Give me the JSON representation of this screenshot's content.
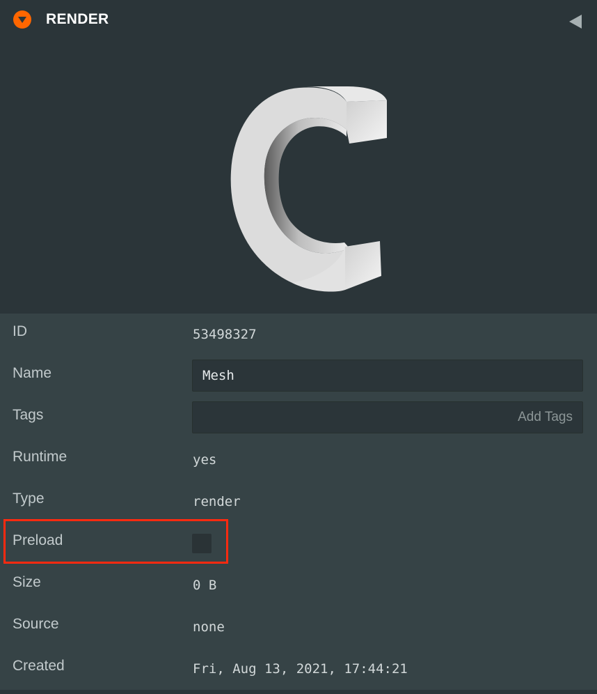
{
  "header": {
    "title": "RENDER",
    "collapse_icon": "chevron-down-icon",
    "collapse_color": "#ff6600",
    "side_icon": "triangle-left-icon"
  },
  "preview": {
    "icon": "letter-c-3d-mesh"
  },
  "fields": {
    "id": {
      "label": "ID",
      "value": "53498327"
    },
    "name": {
      "label": "Name",
      "value": "Mesh"
    },
    "tags": {
      "label": "Tags",
      "placeholder": "Add Tags"
    },
    "runtime": {
      "label": "Runtime",
      "value": "yes"
    },
    "type": {
      "label": "Type",
      "value": "render"
    },
    "preload": {
      "label": "Preload",
      "checked": false
    },
    "size": {
      "label": "Size",
      "value": "0 B"
    },
    "source": {
      "label": "Source",
      "value": "none"
    },
    "created": {
      "label": "Created",
      "value": "Fri, Aug 13, 2021, 17:44:21"
    }
  },
  "highlight_color": "#ff2a10"
}
